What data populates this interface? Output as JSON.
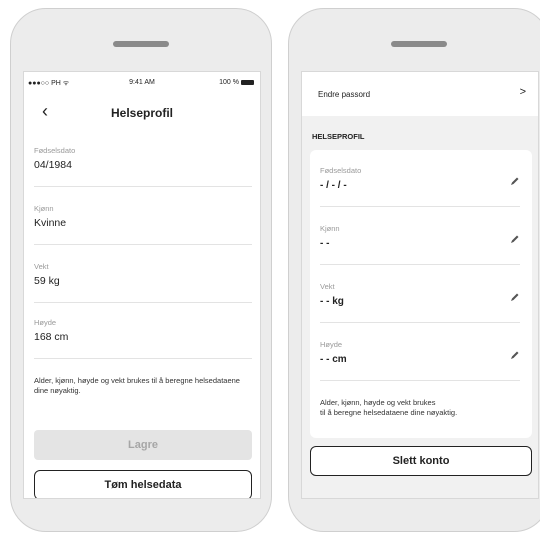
{
  "left": {
    "status": {
      "carrier": "●●●○○ PH ᯤ",
      "time": "9:41 AM",
      "battery": "100 %"
    },
    "title": "Helseprofil",
    "fields": [
      {
        "label": "Fødselsdato",
        "value": "04/1984"
      },
      {
        "label": "Kjønn",
        "value": "Kvinne"
      },
      {
        "label": "Vekt",
        "value": "59 kg"
      },
      {
        "label": "Høyde",
        "value": "168 cm"
      }
    ],
    "info": "Alder, kjønn, høyde og vekt brukes til å beregne helsedataene dine nøyaktig.",
    "save_label": "Lagre",
    "clear_label": "Tøm helsedata"
  },
  "right": {
    "change_password": "Endre passord",
    "chevron": ">",
    "section": "HELSEPROFIL",
    "fields": [
      {
        "label": "Fødselsdato",
        "value": "- / - / -"
      },
      {
        "label": "Kjønn",
        "value": "- -"
      },
      {
        "label": "Vekt",
        "value": "- -  kg"
      },
      {
        "label": "Høyde",
        "value": "- -  cm"
      }
    ],
    "info_line1": "Alder, kjønn, høyde og vekt brukes",
    "info_line2": "til å beregne helsedataene dine nøyaktig.",
    "delete_label": "Slett konto"
  }
}
